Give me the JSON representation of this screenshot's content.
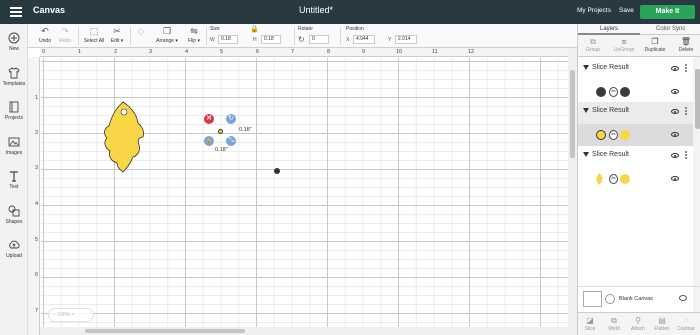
{
  "header": {
    "app_title": "Canvas",
    "document_title": "Untitled*",
    "my_projects": "My Projects",
    "save": "Save",
    "make_it": "Make It"
  },
  "toolbar": {
    "undo": "Undo",
    "redo": "Redo",
    "select_all": "Select All",
    "edit": "Edit",
    "arrange": "Arrange",
    "flip": "Flip",
    "size_label": "Size",
    "w_label": "W",
    "w_value": "0.18",
    "h_label": "H",
    "h_value": "0.18",
    "rotate_label": "Rotate",
    "rotate_value": "0",
    "position_label": "Position",
    "x_label": "X",
    "x_value": "4.944",
    "y_label": "Y",
    "y_value": "2.014"
  },
  "sidebar": {
    "items": [
      {
        "label": "New",
        "icon": "plus-icon"
      },
      {
        "label": "Templates",
        "icon": "shirt-icon"
      },
      {
        "label": "Projects",
        "icon": "book-icon"
      },
      {
        "label": "Images",
        "icon": "image-icon"
      },
      {
        "label": "Text",
        "icon": "text-icon"
      },
      {
        "label": "Shapes",
        "icon": "shapes-icon"
      },
      {
        "label": "Upload",
        "icon": "upload-icon"
      }
    ]
  },
  "canvas": {
    "ruler_top": [
      "0",
      "1",
      "2",
      "3",
      "4",
      "5",
      "6",
      "7",
      "8",
      "9",
      "10",
      "11",
      "12"
    ],
    "ruler_left": [
      "1",
      "2",
      "3",
      "4",
      "5",
      "6",
      "7"
    ],
    "dim_width_label": "0.18\"",
    "dim_height_label": "0.18\"",
    "zoom_label": "100%",
    "leaf_color": "#f9d648",
    "dot_color": "#333333"
  },
  "layers_panel": {
    "tabs": [
      "Layers",
      "Color Sync"
    ],
    "actions": [
      "Group",
      "UnGroup",
      "Duplicate",
      "Delete"
    ],
    "groups": [
      {
        "name": "Slice Result",
        "swatch": "#3a3a3a"
      },
      {
        "name": "Slice Result",
        "swatch": "#f9d648"
      },
      {
        "name": "Slice Result",
        "swatch": "#f9d648"
      }
    ],
    "blank_canvas": "Blank Canvas",
    "bottom_actions": [
      "Slice",
      "Weld",
      "Attach",
      "Flatten",
      "Contour"
    ]
  },
  "colors": {
    "header_bg": "#293942",
    "make_it": "#29a55a",
    "handle_delete": "#e0334a",
    "handle_blue": "#7ba3d6"
  }
}
